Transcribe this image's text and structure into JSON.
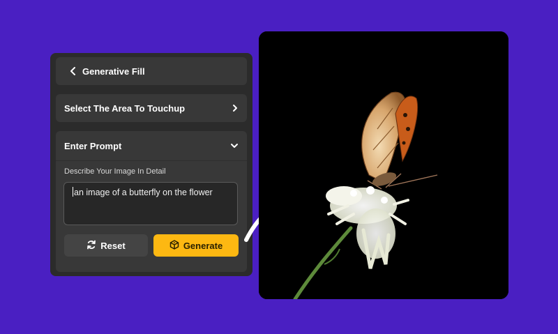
{
  "panel": {
    "header": {
      "back_icon": "chevron-left-icon",
      "title": "Generative Fill"
    },
    "select_area": {
      "label": "Select The Area To Touchup",
      "icon": "chevron-right-icon"
    },
    "prompt_section": {
      "title": "Enter Prompt",
      "icon": "chevron-down-icon",
      "description_label": "Describe Your Image In Detail",
      "prompt_value": "an image of a butterfly on the flower"
    },
    "buttons": {
      "reset": {
        "label": "Reset",
        "icon": "refresh-icon"
      },
      "generate": {
        "label": "Generate",
        "icon": "generate-cube-icon"
      }
    }
  },
  "colors": {
    "background": "#4a1fc2",
    "panel": "#2b2b2b",
    "row": "#383838",
    "generate_button": "#fdb812",
    "reset_button": "#444444"
  },
  "image": {
    "subject": "butterfly-on-flower-photo"
  }
}
